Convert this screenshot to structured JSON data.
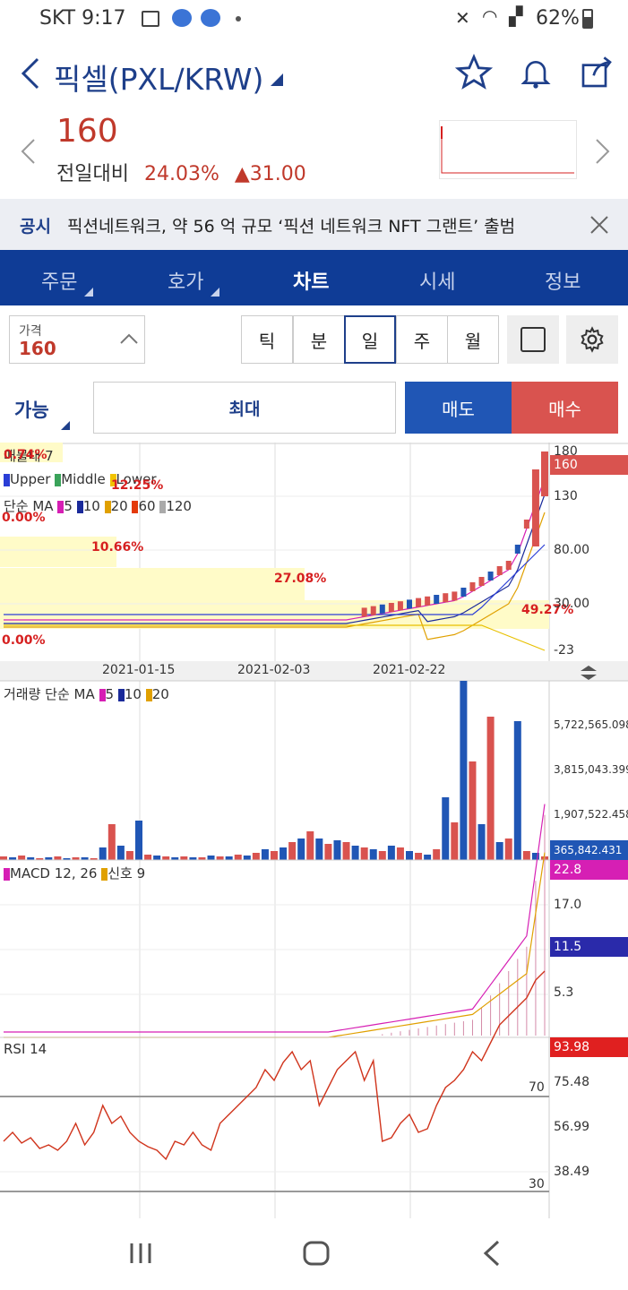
{
  "status": {
    "carrier": "SKT",
    "time": "9:17",
    "battery": "62%"
  },
  "header": {
    "title": "픽셀(PXL/KRW)"
  },
  "quote": {
    "price": "160",
    "change_label": "전일대비",
    "change_pct": "24.03%",
    "change_amt": "▲31.00"
  },
  "notice": {
    "label": "공시",
    "text": "픽션네트워크, 약 56 억 규모 ‘픽션 네트워크 NFT 그랜트’ 출범"
  },
  "tabs": [
    "주문",
    "호가",
    "차트",
    "시세",
    "정보"
  ],
  "active_tab": "차트",
  "controls": {
    "price_label": "가격",
    "price_value": "160",
    "periods": [
      "틱",
      "분",
      "일",
      "주",
      "월"
    ],
    "active_period": "일",
    "available": "가능",
    "max": "최대",
    "sell": "매도",
    "buy": "매수"
  },
  "chart": {
    "overlay_label": "매물대 7",
    "bollinger": [
      "Upper",
      "Middle",
      "Lower"
    ],
    "ma_label": "단순 MA",
    "ma_periods": [
      "5",
      "10",
      "20",
      "60",
      "120"
    ],
    "pcts": [
      "0.74%",
      "12.25%",
      "0.00%",
      "10.66%",
      "27.08%",
      "49.27%",
      "0.00%"
    ],
    "price_axis": [
      "180",
      "160",
      "130",
      "80.00",
      "30.00",
      "-23"
    ],
    "dates": [
      "2021-01-15",
      "2021-02-03",
      "2021-02-22"
    ],
    "volume_label": "거래량 단순 MA",
    "volume_ma": [
      "5",
      "10",
      "20"
    ],
    "volume_axis": [
      "5,722,565.098",
      "3,815,043.399",
      "1,907,522.458",
      "365,842.431"
    ],
    "macd_label": "MACD 12, 26",
    "macd_signal": "신호 9",
    "macd_axis": [
      "22.8",
      "17.0",
      "11.5",
      "5.3"
    ],
    "rsi_label": "RSI 14",
    "rsi_axis": [
      "93.98",
      "75.48",
      "70",
      "56.99",
      "38.49",
      "30"
    ]
  },
  "colors": {
    "brand": "#0f3c96",
    "up": "#c0392b",
    "down": "#2056b5"
  }
}
